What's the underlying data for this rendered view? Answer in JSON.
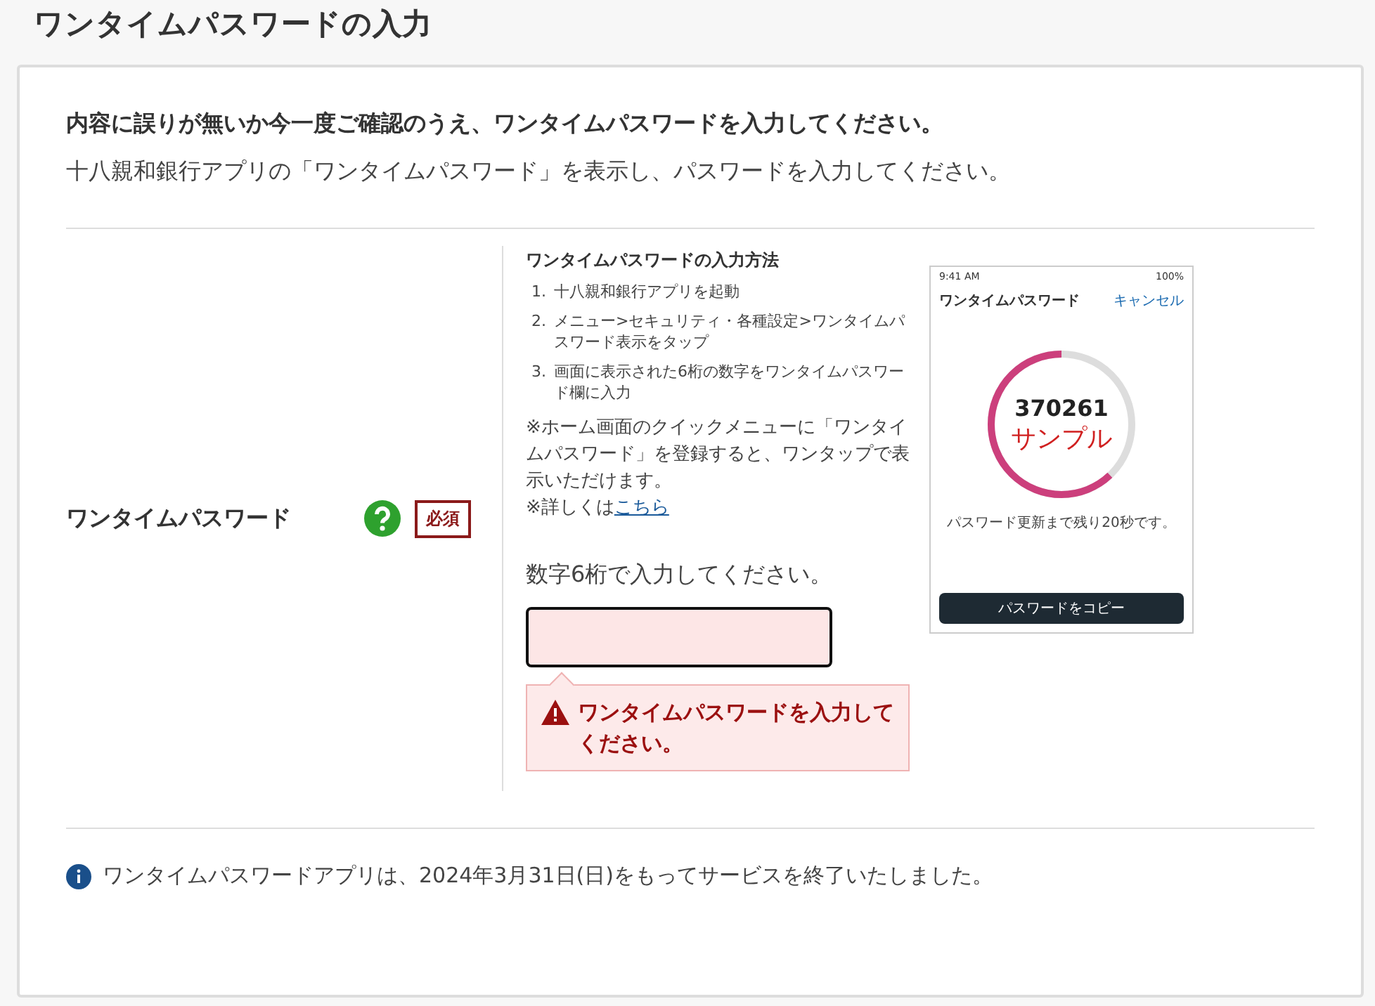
{
  "page_title": "ワンタイムパスワードの入力",
  "intro": {
    "heading": "内容に誤りが無いか今一度ご確認のうえ、ワンタイムパスワードを入力してください。",
    "text": "十八親和銀行アプリの「ワンタイムパスワード」を表示し、パスワードを入力してください。"
  },
  "field": {
    "label": "ワンタイムパスワード",
    "required_badge": "必須",
    "guide": {
      "title": "ワンタイムパスワードの入力方法",
      "steps": [
        {
          "number": "1.",
          "text": "十八親和銀行アプリを起動"
        },
        {
          "number": "2.",
          "text": "メニュー>セキュリティ・各種設定>ワンタイムパスワード表示をタップ"
        },
        {
          "number": "3.",
          "text": "画面に表示された6桁の数字をワンタイムパスワード欄に入力"
        }
      ],
      "note": "※ホーム画面のクイックメニューに「ワンタイムパスワード」を登録すると、ワンタップで表示いただけます。",
      "more_prefix": "※詳しくは",
      "more_link": "こちら"
    },
    "phone": {
      "time": "9:41 AM",
      "battery": "100%",
      "title": "ワンタイムパスワード",
      "cancel": "キャンセル",
      "code": "370261",
      "sample": "サンプル",
      "level": 0.62,
      "remaining": "パスワード更新まで残り20秒です。",
      "copy_button": "パスワードをコピー"
    },
    "hint": "数字6桁で入力してください。",
    "error": true,
    "error_message": "ワンタイムパスワードを入力してください。"
  },
  "notice": "ワンタイムパスワードアプリは、2024年3月31日(日)をもってサービスを終了いたしました。"
}
